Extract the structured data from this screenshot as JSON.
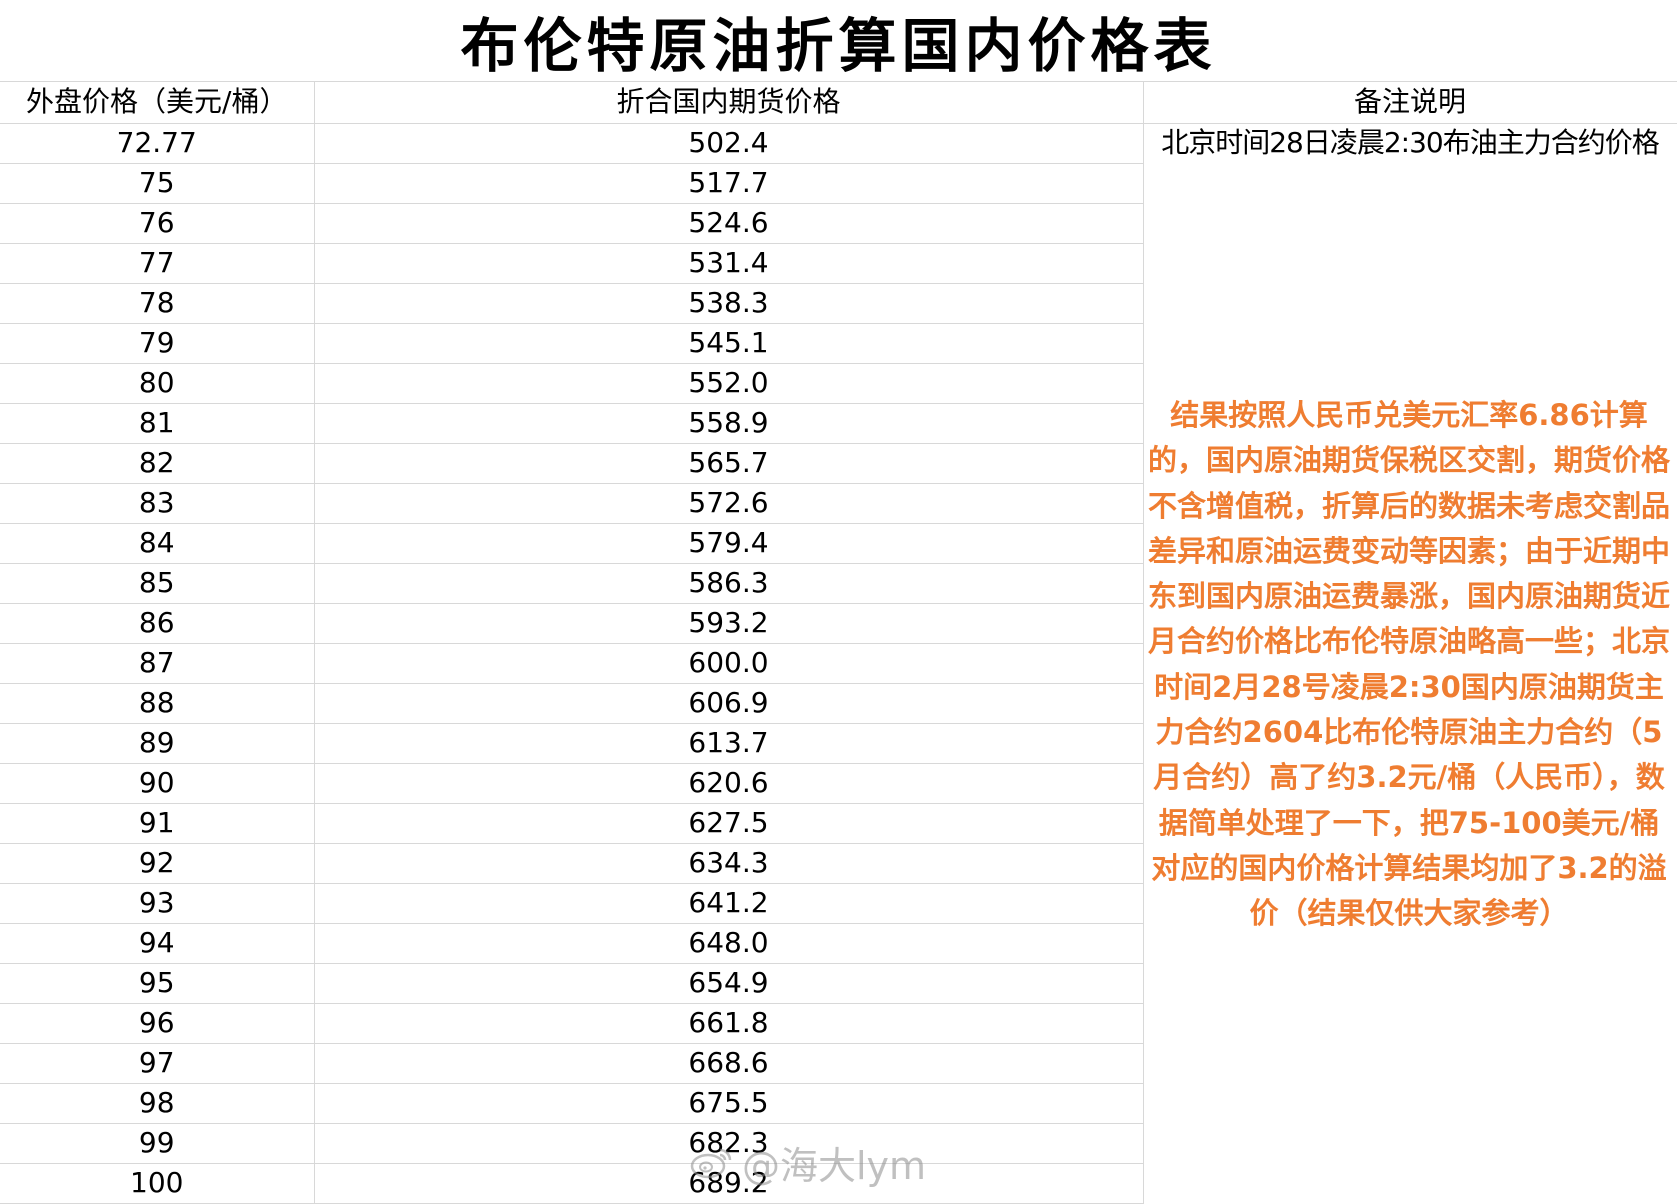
{
  "title": "布伦特原油折算国内价格表",
  "table": {
    "headers": {
      "foreign_price": "外盘价格（美元/桶）",
      "domestic_price": "折合国内期货价格",
      "remarks": "备注说明"
    },
    "rows": [
      {
        "usd": "72.77",
        "cny": "502.4"
      },
      {
        "usd": "75",
        "cny": "517.7"
      },
      {
        "usd": "76",
        "cny": "524.6"
      },
      {
        "usd": "77",
        "cny": "531.4"
      },
      {
        "usd": "78",
        "cny": "538.3"
      },
      {
        "usd": "79",
        "cny": "545.1"
      },
      {
        "usd": "80",
        "cny": "552.0"
      },
      {
        "usd": "81",
        "cny": "558.9"
      },
      {
        "usd": "82",
        "cny": "565.7"
      },
      {
        "usd": "83",
        "cny": "572.6"
      },
      {
        "usd": "84",
        "cny": "579.4"
      },
      {
        "usd": "85",
        "cny": "586.3"
      },
      {
        "usd": "86",
        "cny": "593.2"
      },
      {
        "usd": "87",
        "cny": "600.0"
      },
      {
        "usd": "88",
        "cny": "606.9"
      },
      {
        "usd": "89",
        "cny": "613.7"
      },
      {
        "usd": "90",
        "cny": "620.6"
      },
      {
        "usd": "91",
        "cny": "627.5"
      },
      {
        "usd": "92",
        "cny": "634.3"
      },
      {
        "usd": "93",
        "cny": "641.2"
      },
      {
        "usd": "94",
        "cny": "648.0"
      },
      {
        "usd": "95",
        "cny": "654.9"
      },
      {
        "usd": "96",
        "cny": "661.8"
      },
      {
        "usd": "97",
        "cny": "668.6"
      },
      {
        "usd": "98",
        "cny": "675.5"
      },
      {
        "usd": "99",
        "cny": "682.3"
      },
      {
        "usd": "100",
        "cny": "689.2"
      }
    ],
    "first_row_note": "北京时间28日凌晨2:30布油主力合约价格",
    "remark": "结果按照人民币兑美元汇率6.86计算的，国内原油期货保税区交割，期货价格不含增值税，折算后的数据未考虑交割品差异和原油运费变动等因素；由于近期中东到国内原油运费暴涨，国内原油期货近月合约价格比布伦特原油略高一些；北京时间2月28号凌晨2:30国内原油期货主力合约2604比布伦特原油主力合约（5月合约）高了约3.2元/桶（人民币），数据简单处理了一下，把75-100美元/桶对应的国内价格计算结果均加了3.2的溢价（结果仅供大家参考）"
  },
  "watermark": {
    "text": "@海大lym",
    "icon": "weibo-logo-icon"
  },
  "colors": {
    "remark_text": "#ef7d31",
    "grid_line": "#d8d8d8"
  }
}
